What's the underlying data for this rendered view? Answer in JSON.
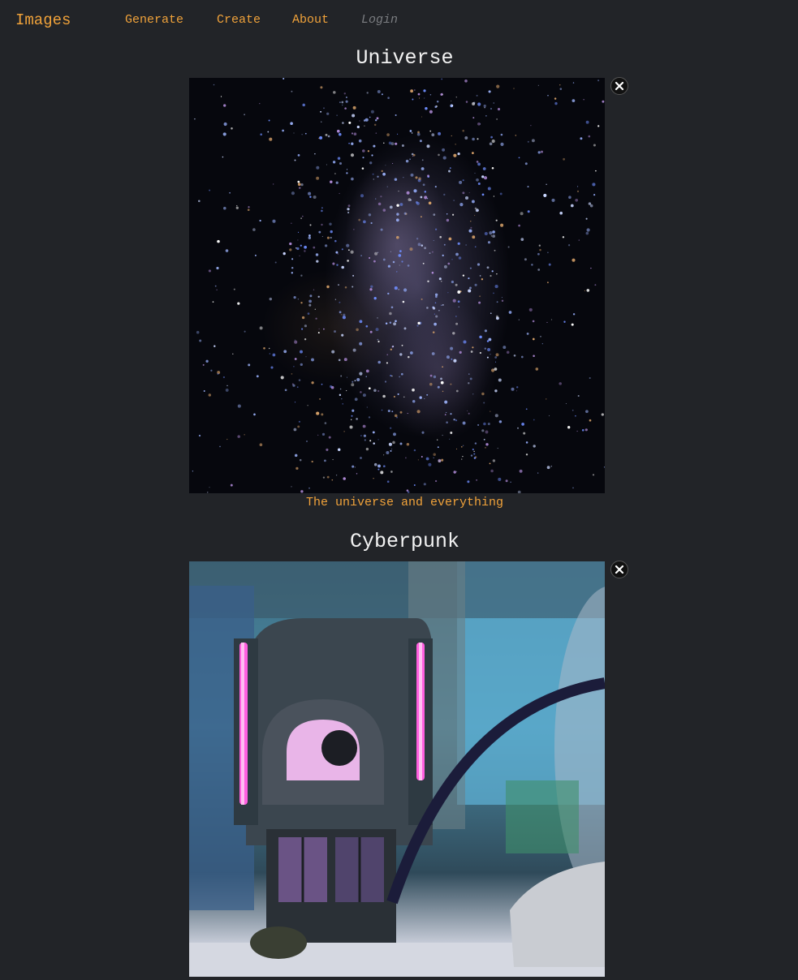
{
  "nav": {
    "brand": "Images",
    "links": [
      "Generate",
      "Create",
      "About"
    ],
    "login": "Login"
  },
  "cards": [
    {
      "title": "Universe",
      "caption": "The universe and everything",
      "image_icon": "starfield-image",
      "close_icon": "close-icon"
    },
    {
      "title": "Cyberpunk",
      "caption": "",
      "image_icon": "cyberpunk-scene-image",
      "close_icon": "close-icon"
    }
  ],
  "colors": {
    "background": "#222428",
    "accent": "#f0a23a",
    "title": "#f2f2f2",
    "disabled": "#7b7d81"
  }
}
